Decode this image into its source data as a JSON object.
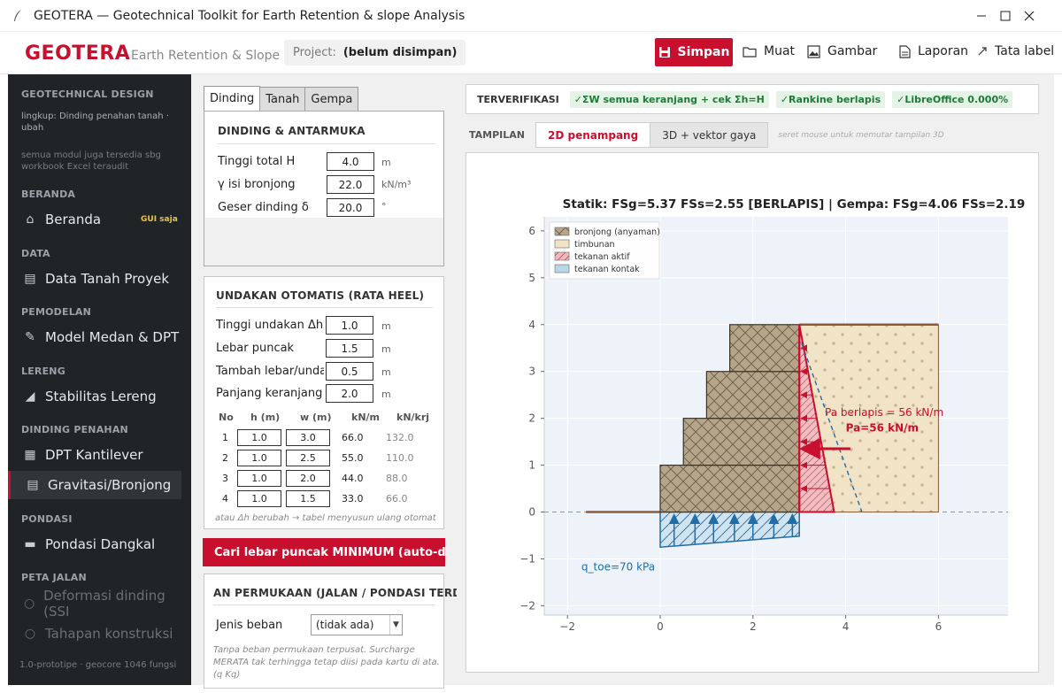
{
  "window": {
    "title": "GEOTERA — Geotechnical Toolkit for Earth Retention & slope Analysis"
  },
  "header": {
    "brand": "GEOTERA",
    "subtitle": "Earth Retention & Slope",
    "project_label": "Project:",
    "project_value": "(belum disimpan)",
    "save": "Simpan",
    "load": "Muat",
    "image": "Gambar",
    "report": "Laporan",
    "labels": "Tata label"
  },
  "sidebar": {
    "section_top": "GEOTECHNICAL DESIGN",
    "scope": "lingkup: Dinding penahan tanah · ubah",
    "modules_note": "semua modul juga tersedia sbg workbook Excel teraudit",
    "sections": {
      "home": "BERANDA",
      "data": "DATA",
      "model": "PEMODELAN",
      "slope": "LERENG",
      "wall": "DINDING PENAHAN",
      "found": "PONDASI",
      "road": "PETA JALAN"
    },
    "items": {
      "home": "Beranda",
      "home_badge": "GUI saja",
      "soil": "Data Tanah Proyek",
      "model": "Model Medan & DPT",
      "slope": "Stabilitas Lereng",
      "cant": "DPT Kantilever",
      "grav": "Gravitasi/Bronjong",
      "shallow": "Pondasi Dangkal",
      "deform": "Deformasi dinding (SSI",
      "stages": "Tahapan konstruksi"
    },
    "version": "1.0-prototipe · geocore 1046 fungsi"
  },
  "panel": {
    "tabs": [
      "Dinding",
      "Tanah",
      "Gempa"
    ],
    "wall": {
      "title": "DINDING & ANTARMUKA",
      "rows": [
        {
          "label": "Tinggi total H",
          "value": "4.0",
          "unit": "m"
        },
        {
          "label": "γ isi bronjong",
          "value": "22.0",
          "unit": "kN/m³"
        },
        {
          "label": "Geser dinding δ",
          "value": "20.0",
          "unit": "°"
        }
      ]
    },
    "steps": {
      "title": "UNDAKAN OTOMATIS (RATA HEEL)",
      "rows": [
        {
          "label": "Tinggi undakan Δh",
          "value": "1.0",
          "unit": "m"
        },
        {
          "label": "Lebar puncak",
          "value": "1.5",
          "unit": "m"
        },
        {
          "label": "Tambah lebar/unda",
          "value": "0.5",
          "unit": "m"
        },
        {
          "label": "Panjang keranjang",
          "value": "2.0",
          "unit": "m"
        }
      ],
      "headers": [
        "No",
        "h (m)",
        "w (m)",
        "kN/m",
        "kN/krj"
      ],
      "table": [
        {
          "no": "1",
          "h": "1.0",
          "w": "3.0",
          "kn": "66.0",
          "krj": "132.0"
        },
        {
          "no": "2",
          "h": "1.0",
          "w": "2.5",
          "kn": "55.0",
          "krj": "110.0"
        },
        {
          "no": "3",
          "h": "1.0",
          "w": "2.0",
          "kn": "44.0",
          "krj": "88.0"
        },
        {
          "no": "4",
          "h": "1.0",
          "w": "1.5",
          "kn": "33.0",
          "krj": "66.0"
        }
      ],
      "note": "atau Δh berubah → tabel menyusun ulang otomat"
    },
    "min_button": "Cari lebar puncak MINIMUM (auto-desai",
    "surcharge": {
      "title": "AN PERMUKAAN (JALAN / PONDASI TERDE",
      "load_label": "Jenis beban",
      "load_value": "(tidak ada)",
      "note1": "Tanpa beban permukaan terpusat. Surcharge",
      "note2": "MERATA tak terhingga tetap diisi pada kartu di ata.",
      "note3": "(q Kq)"
    }
  },
  "verify": {
    "title": "TERVERIFIKASI",
    "chips": [
      "✓ΣW semua keranjang + cek Σh=H",
      "✓Rankine berlapis",
      "✓LibreOffice 0.000%"
    ]
  },
  "view": {
    "label": "TAMPILAN",
    "tabs": [
      "2D penampang",
      "3D + vektor gaya"
    ],
    "hint": "seret mouse untuk memutar tampilan 3D"
  },
  "chart_data": {
    "type": "diagram",
    "title": "Statik: FSg=5.37 FSs=2.55  [BERLAPIS] | Gempa: FSg=4.06 FSs=2.19",
    "xlim": [
      -2.5,
      7.5
    ],
    "ylim": [
      -2.2,
      6.3
    ],
    "xticks": [
      "−2",
      "0",
      "2",
      "4",
      "6"
    ],
    "xtick_values": [
      -2,
      0,
      2,
      4,
      6
    ],
    "yticks": [
      "−2",
      "−1",
      "0",
      "1",
      "2",
      "3",
      "4",
      "5",
      "6"
    ],
    "ytick_values": [
      -2,
      -1,
      0,
      1,
      2,
      3,
      4,
      5,
      6
    ],
    "legend": [
      "bronjong (anyaman)",
      "timbunan",
      "tekanan aktif",
      "tekanan kontak"
    ],
    "legend_colors": [
      "#b5a58a",
      "#f0e3c6",
      "#f2b6bf",
      "#b9d6ea"
    ],
    "baskets": [
      {
        "x0": 0.0,
        "x1": 3.0,
        "y0": 0,
        "y1": 1
      },
      {
        "x0": 0.5,
        "x1": 3.0,
        "y0": 1,
        "y1": 2
      },
      {
        "x0": 1.0,
        "x1": 3.0,
        "y0": 2,
        "y1": 3
      },
      {
        "x0": 1.5,
        "x1": 3.0,
        "y0": 3,
        "y1": 4
      }
    ],
    "backfill": {
      "x0": 3.0,
      "x1": 6.0,
      "y0": 0,
      "y1": 4
    },
    "ground_left": [
      -1.6,
      0
    ],
    "wall_height": 4.0,
    "active_pressure_max": 0.75,
    "contact_q_toe": 70,
    "contact_q_heel": 60,
    "annot_pa_layered": "Pa berlapis = 56 kN/m",
    "annot_pa": "Pa=56 kN/m",
    "annot_qtoe": "q_toe=70 kPa",
    "colors": {
      "accent": "#c8102e",
      "contact": "#1f6ea8",
      "ground": "#8a5a3b"
    }
  }
}
